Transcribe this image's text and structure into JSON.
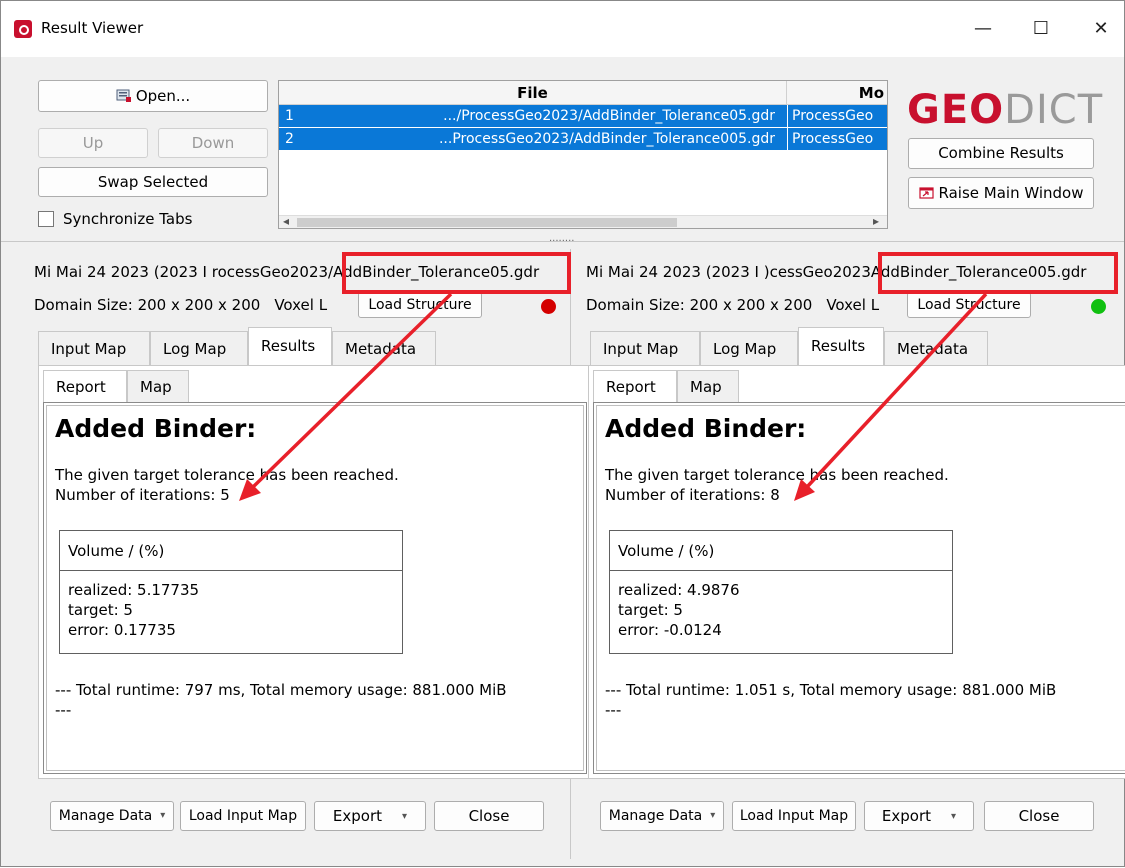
{
  "window": {
    "title": "Result Viewer",
    "minimize": "—",
    "maximize": "☐",
    "close": "✕"
  },
  "toolbar": {
    "open_label": "Open...",
    "up_label": "Up",
    "down_label": "Down",
    "swap_label": "Swap Selected",
    "sync_label": "Synchronize Tabs",
    "sync_checked": false,
    "combine_label": "Combine Results",
    "raise_label": "Raise Main Window"
  },
  "file_table": {
    "headers": [
      "File",
      "Mo"
    ],
    "rows": [
      {
        "index": "1",
        "file": ".../ProcessGeo2023/AddBinder_Tolerance05.gdr",
        "mode": "ProcessGeo"
      },
      {
        "index": "2",
        "file": "...ProcessGeo2023/AddBinder_Tolerance005.gdr",
        "mode": "ProcessGeo"
      }
    ],
    "scroll_left": "◂",
    "scroll_right": "▸"
  },
  "logo": {
    "geo": "GEO",
    "dict": "DICT"
  },
  "splitter_grip": "........",
  "panels": [
    {
      "info_prefix": "Mi Mai 24 2023 (2023 I rocessGeo2023/",
      "info_file": "AddBinder_Tolerance05.gdr",
      "domain_text": "Domain Size: 200 x 200 x 200",
      "voxel_text": "Voxel L",
      "load_structure": "Load Structure",
      "status_color": "#d40000",
      "tabs": [
        "Input Map",
        "Log Map",
        "Results",
        "Metadata"
      ],
      "active_tab": "Results",
      "subtabs": [
        "Report",
        "Map"
      ],
      "report": {
        "heading": "Added Binder:",
        "line1": "The given target tolerance has been reached.",
        "line2": "Number of iterations: 5",
        "volume_header": "Volume / (%)",
        "realized": "realized: 5.17735",
        "target": "target: 5",
        "error": "error: 0.17735",
        "runtime": "--- Total runtime: 797 ms, Total memory usage: 881.000 MiB",
        "end": "---"
      },
      "buttons": {
        "manage": "Manage Data",
        "load_input": "Load Input Map",
        "export": "Export",
        "close": "Close"
      }
    },
    {
      "info_prefix": "Mi Mai 24 2023 (2023 I )cessGeo2023",
      "info_file": "AddBinder_Tolerance005.gdr",
      "domain_text": "Domain Size: 200 x 200 x 200",
      "voxel_text": "Voxel L",
      "load_structure": "Load Structure",
      "status_color": "#10c010",
      "tabs": [
        "Input Map",
        "Log Map",
        "Results",
        "Metadata"
      ],
      "active_tab": "Results",
      "subtabs": [
        "Report",
        "Map"
      ],
      "report": {
        "heading": "Added Binder:",
        "line1": "The given target tolerance has been reached.",
        "line2": "Number of iterations: 8",
        "volume_header": "Volume / (%)",
        "realized": "realized: 4.9876",
        "target": "target: 5",
        "error": "error: -0.0124",
        "runtime": "--- Total runtime: 1.051 s, Total memory usage: 881.000 MiB",
        "end": "---"
      },
      "buttons": {
        "manage": "Manage Data",
        "load_input": "Load Input Map",
        "export": "Export",
        "close": "Close"
      }
    }
  ],
  "annotation_color": "#e8202a"
}
